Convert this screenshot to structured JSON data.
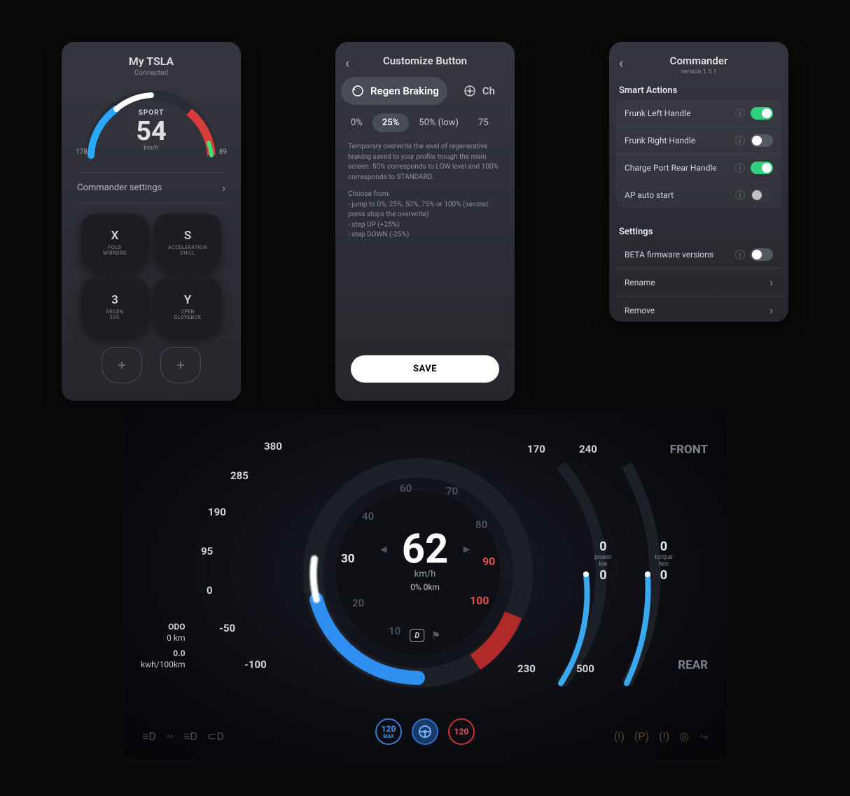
{
  "panel1": {
    "title": "My TSLA",
    "subtitle": "Connected",
    "mode": "SPORT",
    "speed": "54",
    "unit": "km/h",
    "mark_left": "178",
    "mark_right": "89",
    "settings_row": "Commander settings",
    "buttons": [
      {
        "key": "X",
        "label": "FOLD\nMIRRORS"
      },
      {
        "key": "S",
        "label": "ACCELERATION\nCHILL"
      },
      {
        "key": "3",
        "label": "REGEN\n25%"
      },
      {
        "key": "Y",
        "label": "OPEN\nGLOVEBOX"
      }
    ]
  },
  "panel2": {
    "title": "Customize Button",
    "pill_active": "Regen Braking",
    "pill_next": "Ch",
    "options": [
      "0%",
      "25%",
      "50% (low)",
      "75"
    ],
    "selected_index": 1,
    "desc_p1": "Temporary overwrite the level of regenerative braking saved to your profile trough the main screen. 50% corresponds to LOW level and 100% corresponds to STANDARD.",
    "desc_p2_head": "Choose from:",
    "desc_l1": "- jump to 0%, 25%, 50%, 75% or 100% (second press stops the overwrite)",
    "desc_l2": "- step UP (+25%)",
    "desc_l3": "- step DOWN (-25%)",
    "save": "SAVE"
  },
  "panel3": {
    "title": "Commander",
    "version": "version 1.5.1",
    "section1": "Smart Actions",
    "actions": [
      {
        "label": "Frunk Left Handle",
        "on": true
      },
      {
        "label": "Frunk Right Handle",
        "on": false
      },
      {
        "label": "Charge Port Rear Handle",
        "on": true
      },
      {
        "label": "AP auto start",
        "on": false,
        "disabled": true
      }
    ],
    "section2": "Settings",
    "beta_row": "BETA firmware versions",
    "beta_on": false,
    "rename": "Rename",
    "remove": "Remove"
  },
  "dash": {
    "front": "FRONT",
    "rear": "REAR",
    "speed": "62",
    "unit": "km/h",
    "subinfo": "0%   0km",
    "gear": "D",
    "odo_label": "ODO",
    "odo_val": "0 km",
    "eff_val": "0.0",
    "eff_unit": "kwh/100km",
    "left_scale": [
      "380",
      "285",
      "190",
      "95",
      "0",
      "-50",
      "-100"
    ],
    "inner_left": [
      "60",
      "40",
      "30",
      "20",
      "10"
    ],
    "inner_right_top": [
      "70",
      "80"
    ],
    "inner_right_red": [
      "90",
      "100"
    ],
    "right_scale_a": [
      "170",
      "0",
      "0",
      "230"
    ],
    "right_scale_b": [
      "240",
      "0",
      "0",
      "500"
    ],
    "power_label": "power",
    "power_unit": "Kw",
    "torque_label": "torque",
    "torque_unit": "Nm",
    "limit_max": "120",
    "limit_max_sub": "MAX",
    "limit_set": "120"
  }
}
